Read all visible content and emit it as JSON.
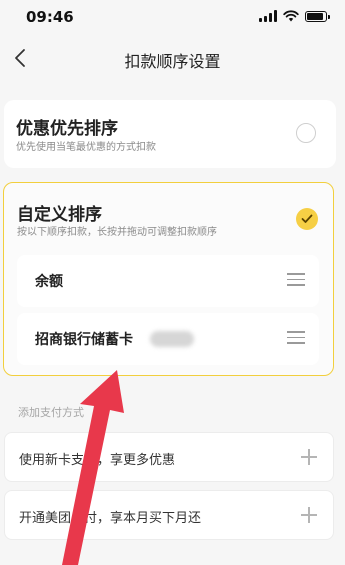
{
  "status_bar": {
    "time": "09:46"
  },
  "nav": {
    "title": "扣款顺序设置"
  },
  "preferential": {
    "title": "优惠优先排序",
    "subtitle": "优先使用当笔最优惠的方式扣款",
    "selected": false
  },
  "custom": {
    "title": "自定义排序",
    "subtitle": "按以下顺序扣款，长按并拖动可调整扣款顺序",
    "selected": true,
    "items": [
      {
        "label": "余额"
      },
      {
        "label": "招商银行储蓄卡"
      }
    ]
  },
  "add_payment": {
    "section_label": "添加支付方式",
    "options": [
      {
        "label": "使用新卡支付，享更多优惠"
      },
      {
        "label": "开通美团月付，享本月买下月还"
      }
    ]
  },
  "colors": {
    "accent": "#f6cf45",
    "annotation_arrow": "#e8384b"
  }
}
